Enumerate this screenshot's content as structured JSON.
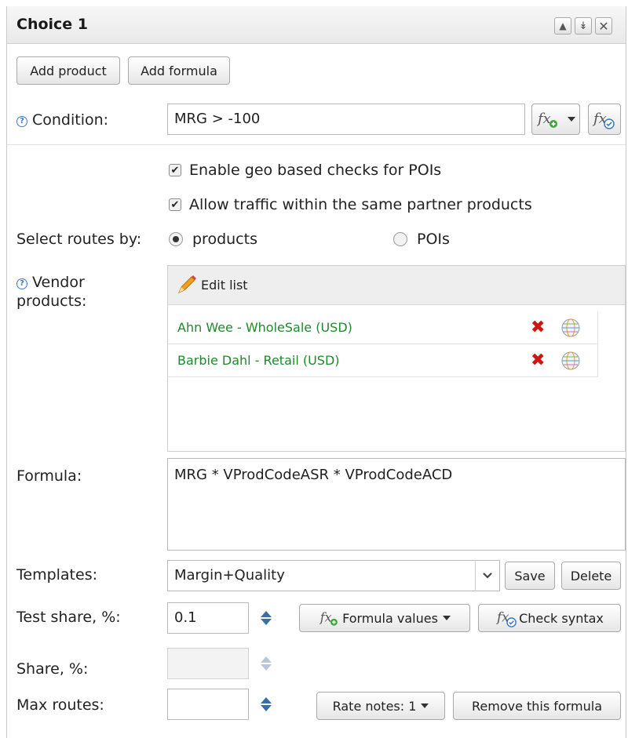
{
  "window": {
    "title": "Choice 1"
  },
  "toolbar": {
    "add_product": "Add product",
    "add_formula": "Add formula"
  },
  "condition": {
    "label": "Condition:",
    "value": "MRG > -100"
  },
  "options": {
    "geo_checks": "Enable geo based checks for POIs",
    "allow_traffic": "Allow traffic within the same partner products"
  },
  "routes": {
    "label": "Select routes by:",
    "option_products": "products",
    "option_pois": "POIs",
    "selected": "products"
  },
  "vendor": {
    "label_line1": "Vendor",
    "label_line2": "products:",
    "edit_list": "Edit list",
    "items": [
      {
        "name": "Ahn Wee - WholeSale (USD)"
      },
      {
        "name": "Barbie Dahl - Retail (USD)"
      }
    ]
  },
  "formula": {
    "label": "Formula:",
    "value": "MRG * VProdCodeASR * VProdCodeACD"
  },
  "templates": {
    "label": "Templates:",
    "value": "Margin+Quality",
    "save": "Save",
    "delete": "Delete"
  },
  "test_share": {
    "label": "Test share, %:",
    "value": "0.1",
    "formula_values": "Formula values",
    "check_syntax": "Check syntax"
  },
  "share": {
    "label": "Share, %:",
    "value": ""
  },
  "max_routes": {
    "label": "Max routes:",
    "value": "",
    "rate_notes": "Rate notes: 1",
    "remove_formula": "Remove this formula"
  },
  "colors": {
    "vendor_text": "#1e8a2b",
    "delete_icon": "#d01515",
    "help_icon": "#3b78c9",
    "spinner": "#3a6ea5"
  }
}
